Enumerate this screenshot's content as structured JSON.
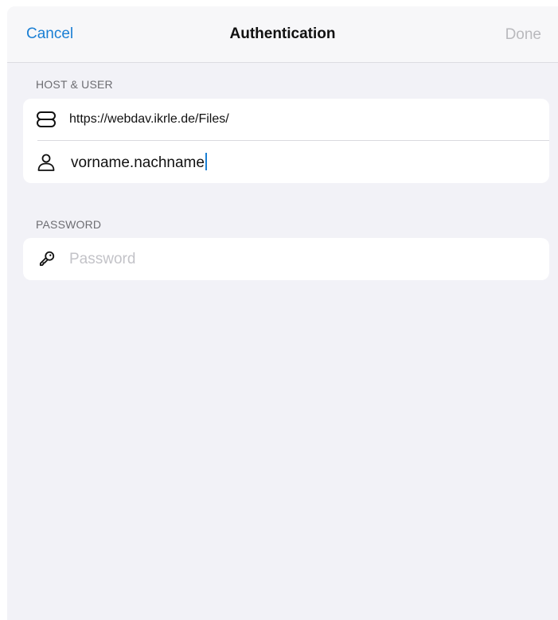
{
  "navbar": {
    "cancel_label": "Cancel",
    "title": "Authentication",
    "done_label": "Done"
  },
  "host_user": {
    "header": "HOST & USER",
    "host_value": "https://webdav.ikrle.de/Files/",
    "host_icon": "server-icon",
    "user_value": "vorname.nachname",
    "user_icon": "person-icon"
  },
  "password": {
    "header": "PASSWORD",
    "placeholder": "Password",
    "icon": "key-icon"
  },
  "colors": {
    "accent": "#1a7fd4",
    "disabled": "#b9b9bd",
    "background": "#f2f2f7"
  }
}
